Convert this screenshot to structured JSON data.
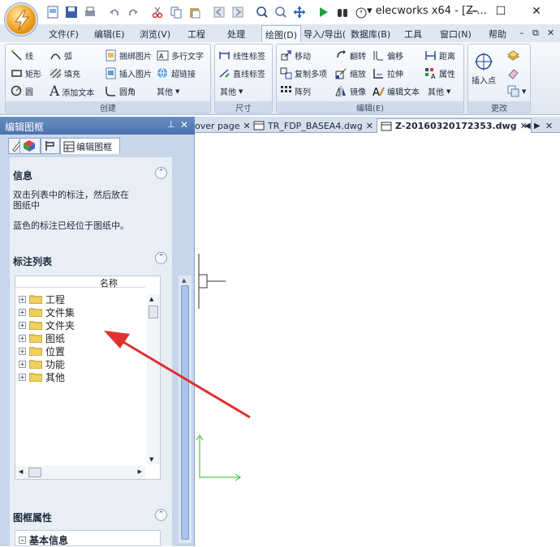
{
  "window": {
    "title": "elecworks x64 - [Z-..."
  },
  "menu": [
    "文件(F)",
    "编辑(E)",
    "浏览(V)",
    "工程",
    "处理",
    "绘图(D)",
    "导入/导出(",
    "数据库(B)",
    "工具",
    "窗口(N)",
    "帮助"
  ],
  "ribbon": {
    "create": {
      "label": "创建",
      "line": "线",
      "arc": "弧",
      "bind_image": "捆绑图片",
      "mtext": "多行文字",
      "rect": "矩形",
      "fill": "填充",
      "insert_image": "插入图片",
      "hyperlink": "超链接",
      "circle": "圆",
      "add_text": "添加文本",
      "fillet": "圆角",
      "more": "其他"
    },
    "dimension": {
      "label": "尺寸",
      "linear": "线性标签",
      "aligned": "直线标签",
      "more": "其他"
    },
    "edit": {
      "label": "编辑(E)",
      "move": "移动",
      "rotate": "翻转",
      "offset": "偏移",
      "distance": "距离",
      "copy_multi": "复制多项",
      "scale": "缩放",
      "stretch": "拉伸",
      "attribute": "属性",
      "array": "阵列",
      "mirror": "镜像",
      "edit_text": "编辑文本",
      "more": "其他"
    },
    "change": {
      "label": "更改",
      "insert_point": "插入点"
    }
  },
  "panel": {
    "title": "编辑图框",
    "tab_label": "编辑图框",
    "info_title": "信息",
    "info_line1": "双击列表中的标注，然后放在",
    "info_line2": "图纸中",
    "info_line3": "蓝色的标注已经位于图纸中。",
    "list_title": "标注列表",
    "list_col": "名称",
    "items": [
      "工程",
      "文件集",
      "文件夹",
      "图纸",
      "位置",
      "功能",
      "其他"
    ],
    "props_title": "图框属性",
    "props_row": "基本信息"
  },
  "doc_tabs": [
    "over page",
    "TR_FDP_BASEA4.dwg",
    "Z-20160320172353.dwg"
  ],
  "colors": {
    "annotation_arrow": "#e03030",
    "ucs_axis": "#20c020",
    "panel_header": "#5a80b8"
  }
}
